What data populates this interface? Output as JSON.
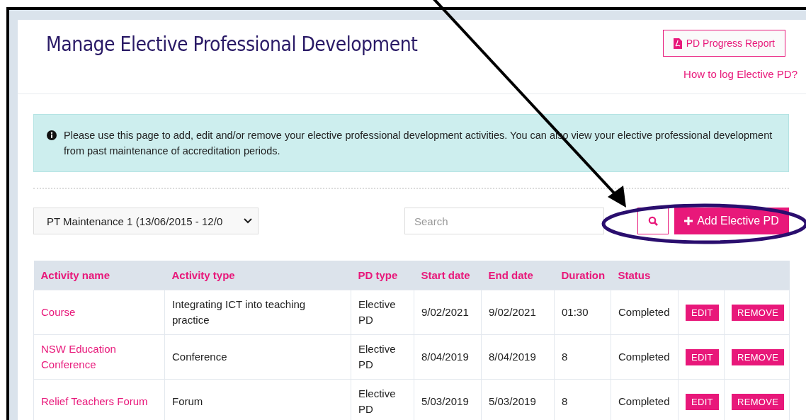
{
  "page": {
    "title": "Manage Elective Professional Development"
  },
  "header_actions": {
    "report_button": "PD Progress Report",
    "help_link": "How to log Elective PD?"
  },
  "info_alert": {
    "text": "Please use this page to add, edit and/or remove your elective professional development activities. You can also view your elective professional development from past maintenance of accreditation periods."
  },
  "toolbar": {
    "period_select": "PT Maintenance 1 (13/06/2015 - 12/0",
    "search": {
      "placeholder": "Search"
    },
    "add_button": "Add Elective PD"
  },
  "table": {
    "columns": [
      "Activity name",
      "Activity type",
      "PD type",
      "Start date",
      "End date",
      "Duration",
      "Status"
    ],
    "rows": [
      {
        "activity_name": "Course",
        "activity_type": "Integrating ICT into teaching practice",
        "pd_type": "Elective PD",
        "start_date": "9/02/2021",
        "end_date": "9/02/2021",
        "duration": "01:30",
        "status": "Completed",
        "actions": [
          "EDIT",
          "REMOVE"
        ]
      },
      {
        "activity_name": "NSW Education Conference",
        "activity_type": "Conference",
        "pd_type": "Elective PD",
        "start_date": "8/04/2019",
        "end_date": "8/04/2019",
        "duration": "8",
        "status": "Completed",
        "actions": [
          "EDIT",
          "REMOVE"
        ]
      },
      {
        "activity_name": "Relief Teachers Forum",
        "activity_type": "Forum",
        "pd_type": "Elective PD",
        "start_date": "5/03/2019",
        "end_date": "5/03/2019",
        "duration": "8",
        "status": "Completed",
        "actions": [
          "EDIT",
          "REMOVE"
        ]
      }
    ]
  },
  "annotations": [
    {
      "kind": "arrow",
      "color": "#000000"
    },
    {
      "kind": "ellipse",
      "color": "#2a0e6e"
    }
  ]
}
